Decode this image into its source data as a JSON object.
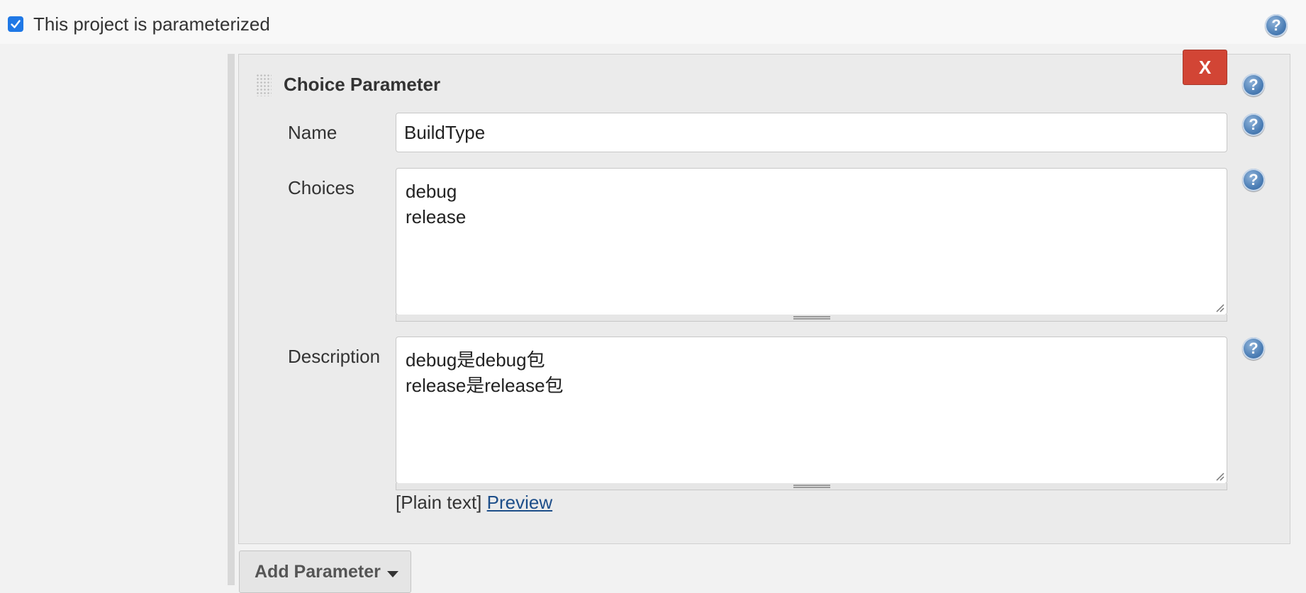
{
  "header": {
    "checkbox_label": "This project is parameterized",
    "checkbox_checked": true,
    "help_icon": "question-circle-icon"
  },
  "parameter": {
    "title": "Choice Parameter",
    "delete_label": "X",
    "name_label": "Name",
    "name_value": "BuildType",
    "choices_label": "Choices",
    "choices_lines": [
      "debug",
      "release"
    ],
    "description_label": "Description",
    "description_lines": [
      "debug是debug包",
      "release是release包"
    ],
    "format_prefix": "[Plain text]",
    "preview_link": "Preview"
  },
  "add_parameter": {
    "label": "Add Parameter",
    "icon": "caret-down-icon"
  },
  "colors": {
    "checkbox": "#1f78e6",
    "delete_button": "#d24535",
    "link": "#1d4e89",
    "help_icon": "#4d7fb6"
  }
}
